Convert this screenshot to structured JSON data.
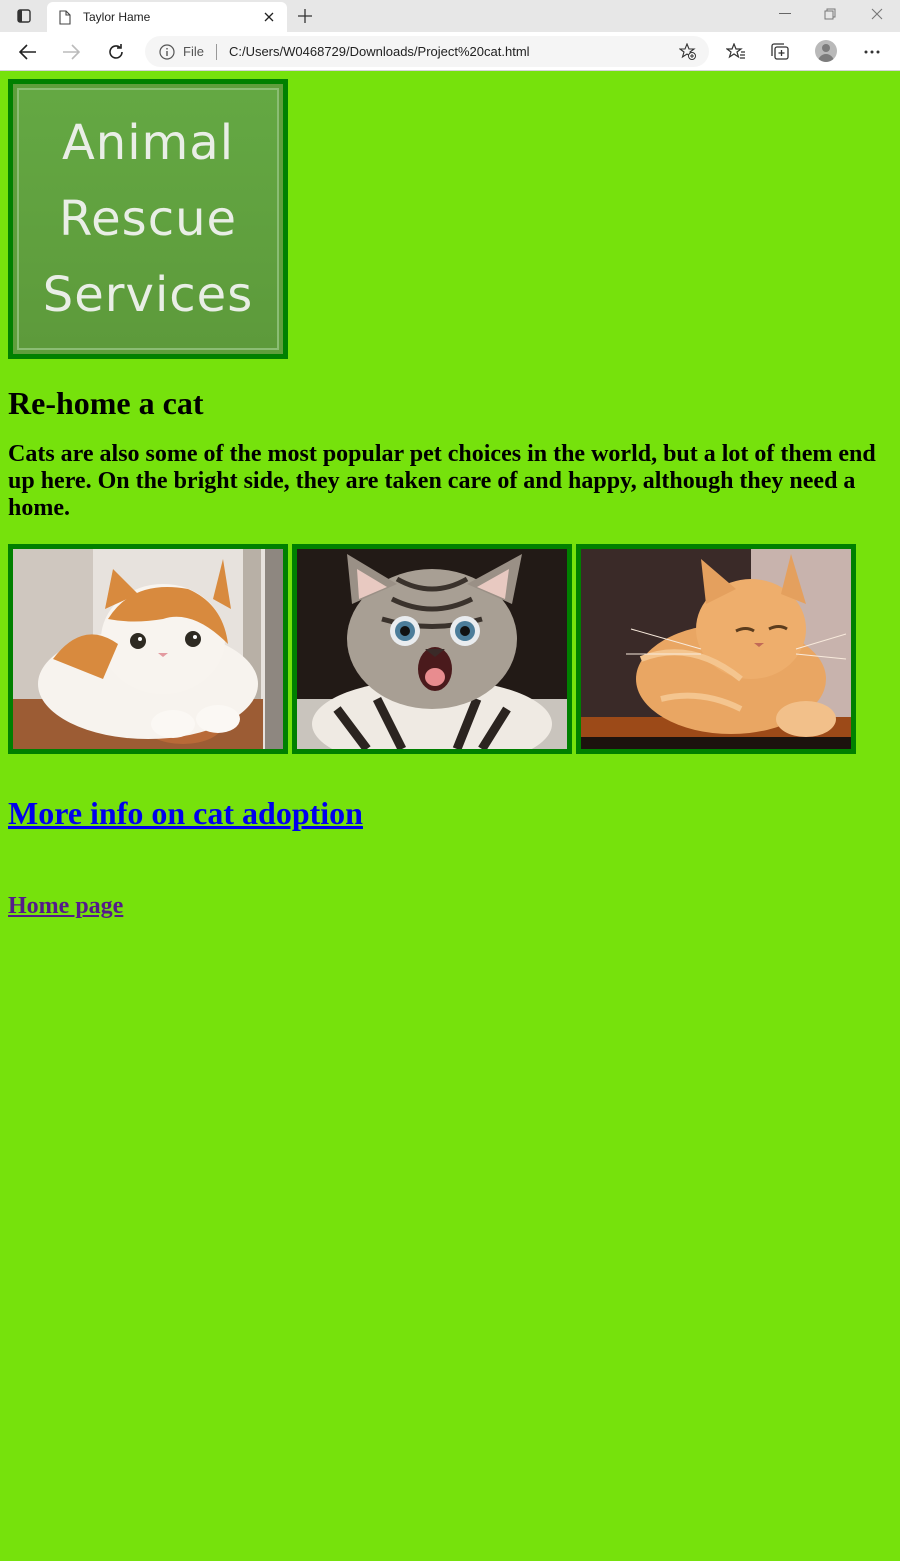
{
  "browser": {
    "tab_title": "Taylor Hame",
    "scheme_label": "File",
    "url": "C:/Users/W0468729/Downloads/Project%20cat.html"
  },
  "page": {
    "logo_lines": [
      "Animal",
      "Rescue",
      "Services"
    ],
    "heading": "Re-home a cat",
    "description": "Cats are also some of the most popular pet choices in the world, but a lot of them end up here. On the bright side, they are taken care of and happy, although they need a home.",
    "more_info_link": "More info on cat adoption",
    "home_link": "Home page"
  },
  "colors": {
    "page_background": "#76e20c",
    "image_border": "#008000",
    "link": "#0000ee",
    "visited_link": "#551a8b"
  },
  "icons": {
    "tab_actions": "tab-actions-icon",
    "page": "page-icon",
    "close": "close-icon",
    "new_tab": "plus-icon",
    "minimize": "minimize-icon",
    "restore": "restore-icon",
    "window_close": "window-close-icon",
    "back": "back-arrow-icon",
    "forward": "forward-arrow-icon",
    "refresh": "refresh-icon",
    "info": "info-icon",
    "add_favorite": "add-favorite-icon",
    "favorites": "favorites-icon",
    "collections": "collections-icon",
    "profile": "profile-icon",
    "more": "more-icon"
  }
}
